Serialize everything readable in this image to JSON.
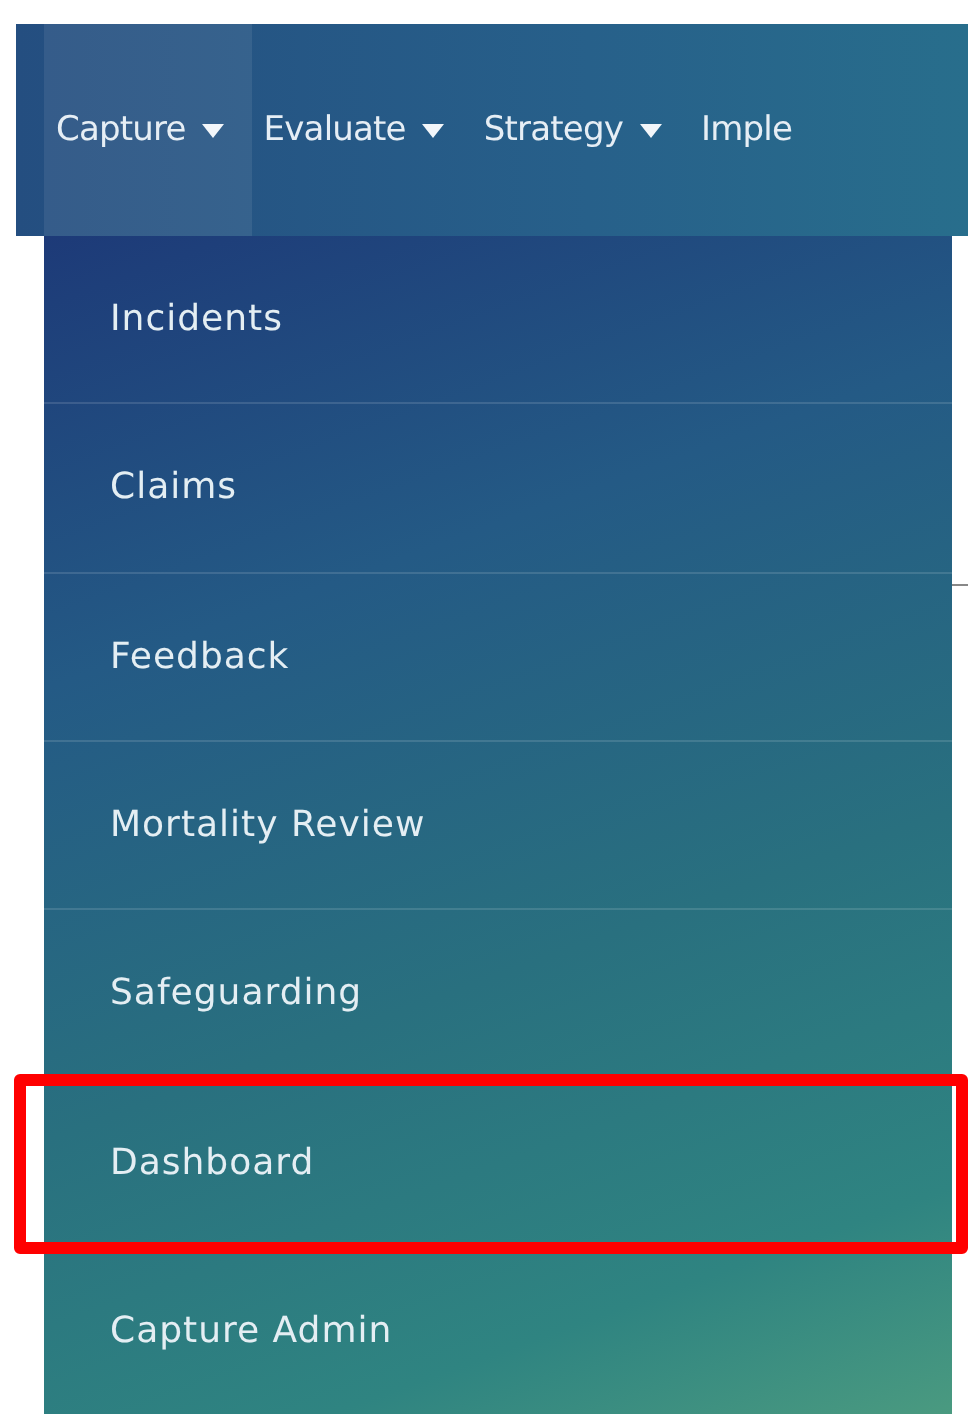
{
  "nav": {
    "items": [
      {
        "label": "Capture",
        "selected": true,
        "caret": true
      },
      {
        "label": "Evaluate",
        "selected": false,
        "caret": true
      },
      {
        "label": "Strategy",
        "selected": false,
        "caret": true
      },
      {
        "label": "Imple",
        "selected": false,
        "caret": false
      }
    ]
  },
  "dropdown": {
    "items": [
      {
        "label": "Incidents",
        "marked": false
      },
      {
        "label": "Claims",
        "marked": false
      },
      {
        "label": "Feedback",
        "marked": false
      },
      {
        "label": "Mortality Review",
        "marked": false
      },
      {
        "label": "Safeguarding",
        "marked": false
      },
      {
        "label": "Dashboard",
        "marked": true
      },
      {
        "label": "Capture Admin",
        "marked": false
      }
    ]
  }
}
